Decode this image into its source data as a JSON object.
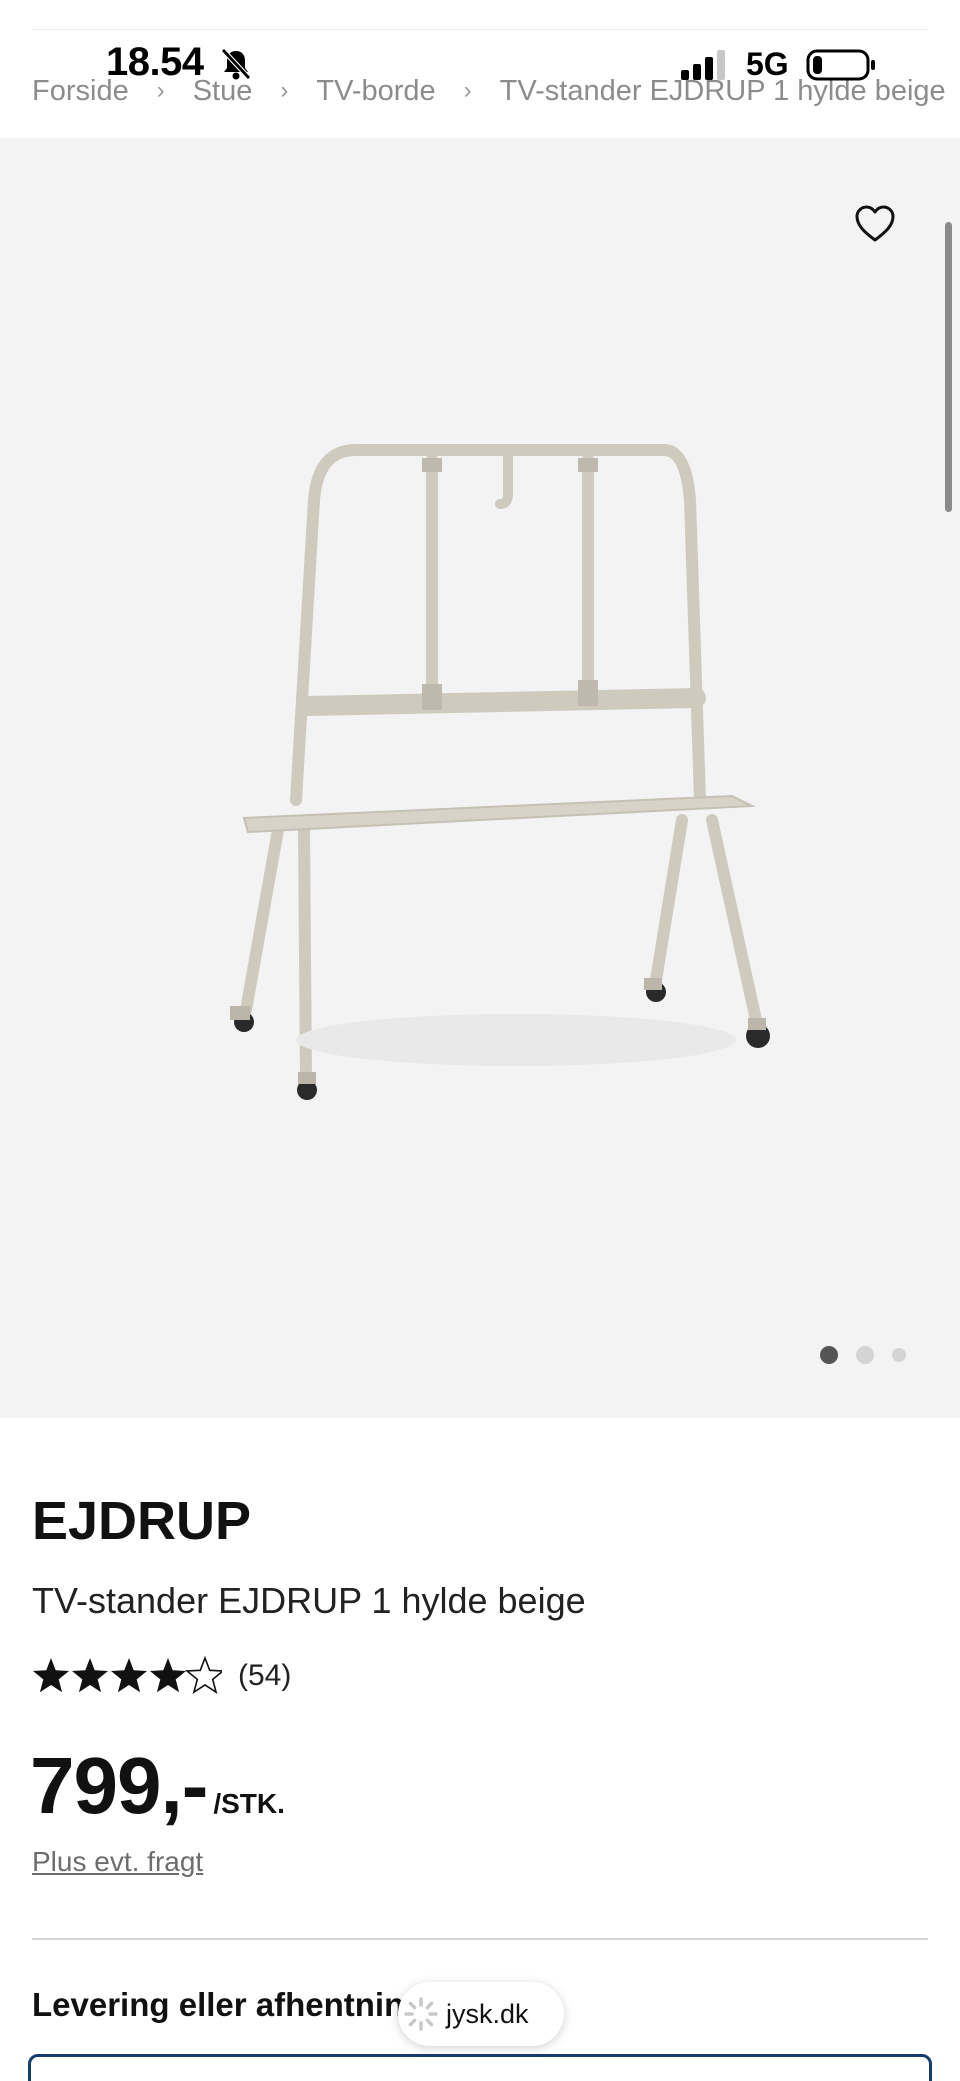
{
  "status_bar": {
    "time": "18.54",
    "network": "5G",
    "bell_icon": "bell-slash-icon",
    "signal_icon": "cellular-signal-icon",
    "battery_icon": "battery-low-icon"
  },
  "breadcrumb": {
    "items": [
      "Forside",
      "Stue",
      "TV-borde",
      "TV-stander EJDRUP 1 hylde beige"
    ],
    "separator_icon": "chevron-right-icon"
  },
  "gallery": {
    "favorite_icon": "heart-outline-icon",
    "image_count": 3,
    "active_index": 0
  },
  "product": {
    "brand": "EJDRUP",
    "title": "TV-stander EJDRUP 1 hylde beige",
    "rating_value": 4.5,
    "rating_count": "(54)",
    "price": "799,-",
    "unit": "/STK.",
    "freight_link": "Plus evt. fragt"
  },
  "delivery": {
    "heading": "Levering eller afhentning"
  },
  "url_bar": {
    "domain": "jysk.dk"
  },
  "colors": {
    "gallery_bg": "#f3f3f3",
    "accent_border": "#143c6e",
    "breadcrumb_text": "#8c8c8c",
    "product_frame": "#cfcabe"
  }
}
